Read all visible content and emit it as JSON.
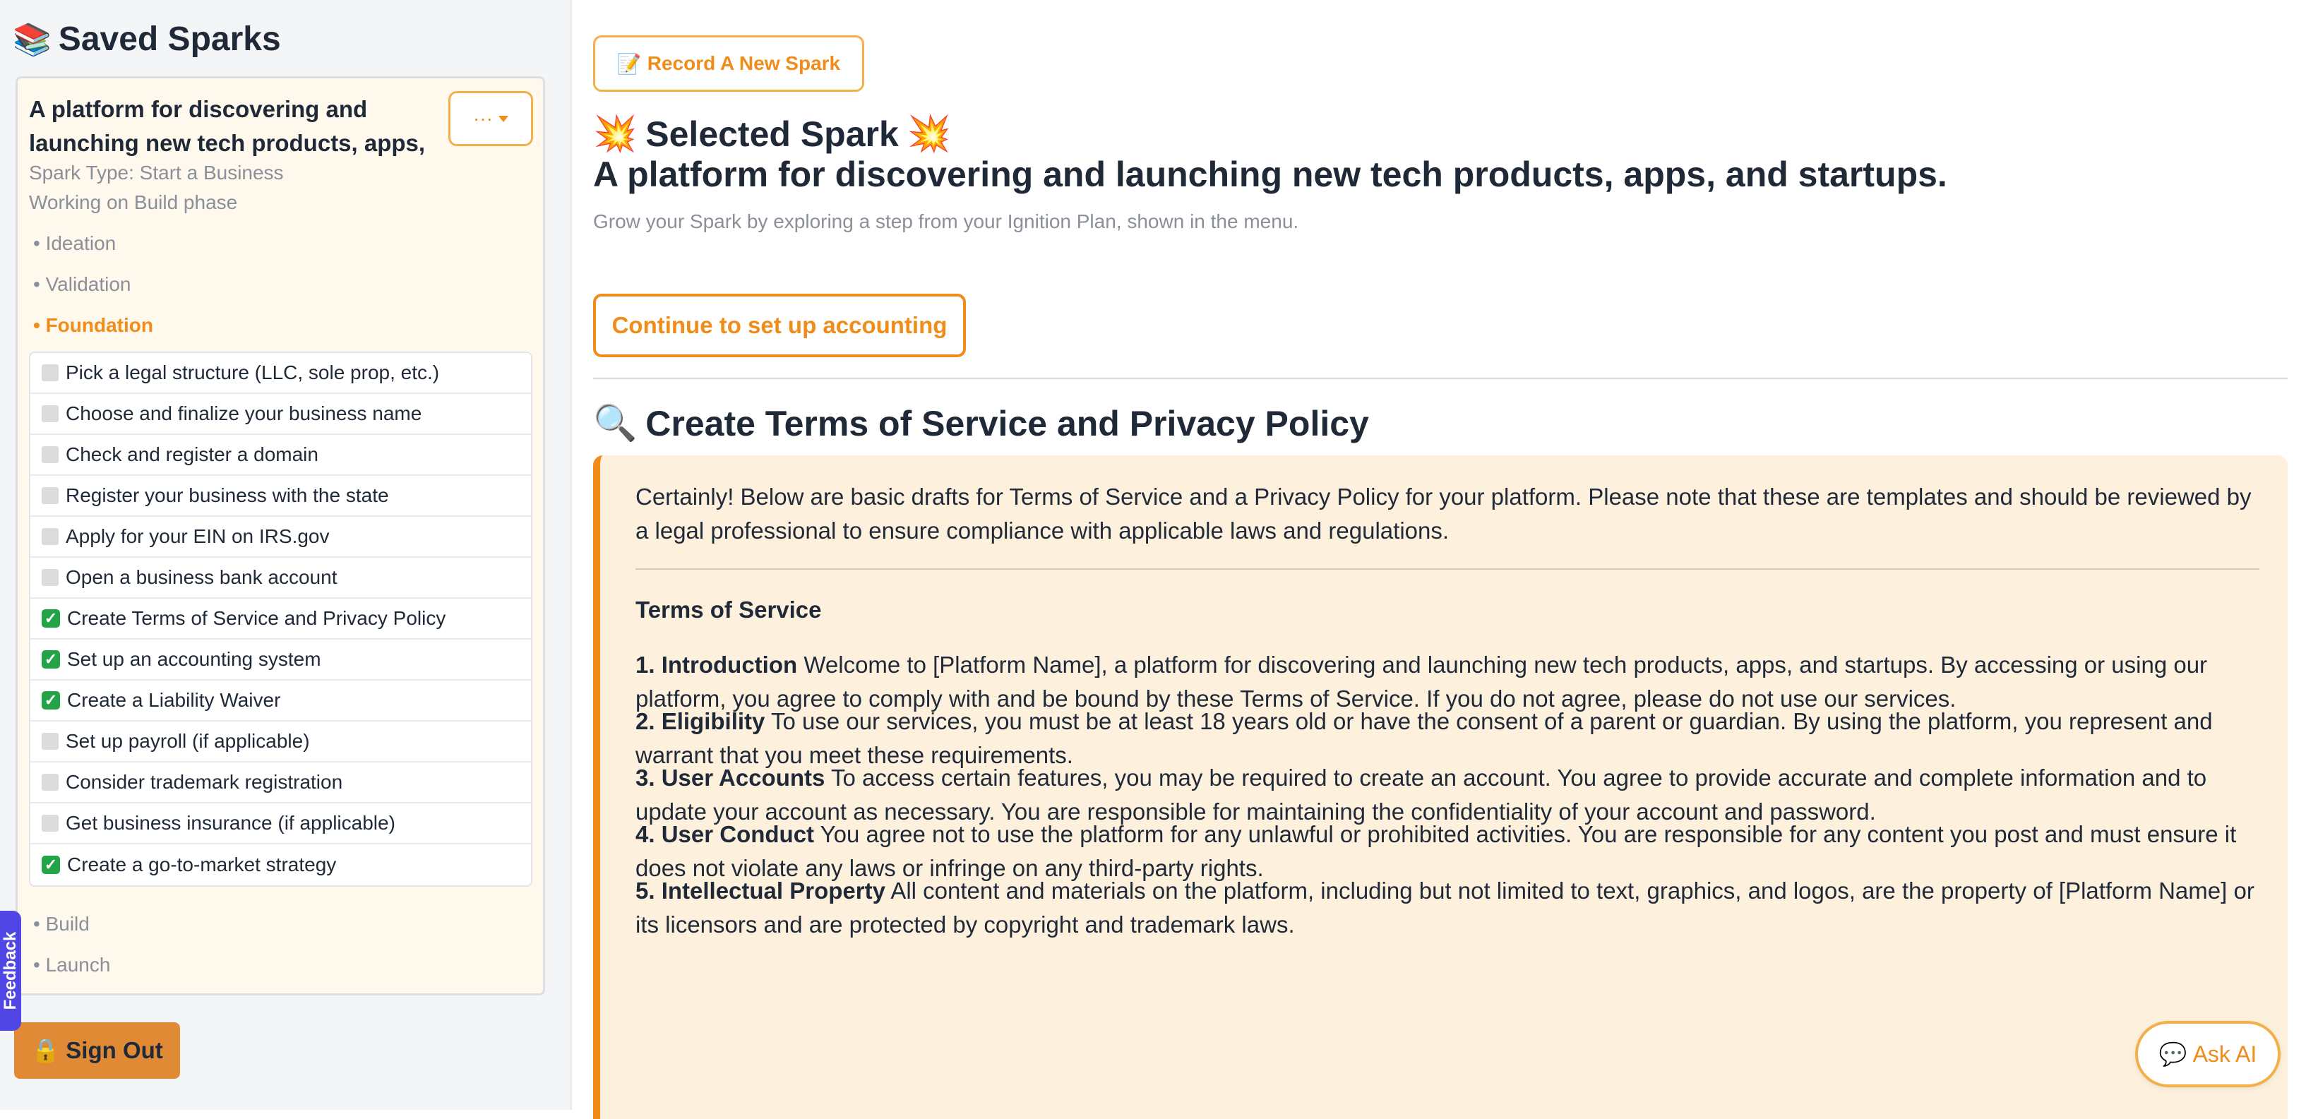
{
  "sidebar": {
    "title": "Saved Sparks",
    "title_icon": "📚",
    "card": {
      "title": "A platform for discovering and launching new tech products, apps, and startups.",
      "menu_label": "···",
      "spark_type": "Spark Type: Start a Business",
      "working_on": "Working on Build phase",
      "phases": [
        {
          "label": "• Ideation",
          "active": false
        },
        {
          "label": "• Validation",
          "active": false
        },
        {
          "label": "• Foundation",
          "active": true
        }
      ],
      "tasks": [
        {
          "label": "Pick a legal structure (LLC, sole prop, etc.)",
          "done": false
        },
        {
          "label": "Choose and finalize your business name",
          "done": false
        },
        {
          "label": "Check and register a domain",
          "done": false
        },
        {
          "label": "Register your business with the state",
          "done": false
        },
        {
          "label": "Apply for your EIN on IRS.gov",
          "done": false
        },
        {
          "label": "Open a business bank account",
          "done": false
        },
        {
          "label": "Create Terms of Service and Privacy Policy",
          "done": true
        },
        {
          "label": "Set up an accounting system",
          "done": true
        },
        {
          "label": "Create a Liability Waiver",
          "done": true
        },
        {
          "label": "Set up payroll (if applicable)",
          "done": false
        },
        {
          "label": "Consider trademark registration",
          "done": false
        },
        {
          "label": "Get business insurance (if applicable)",
          "done": false
        },
        {
          "label": "Create a go-to-market strategy",
          "done": true
        }
      ],
      "later_phases": [
        "• Build",
        "• Launch"
      ]
    },
    "signout_icon": "🔒",
    "signout_label": "Sign Out",
    "feedback_label": "Feedback"
  },
  "main": {
    "record_icon": "📝",
    "record_label": "Record A New Spark",
    "selected_icon": "💥",
    "selected_label": "Selected Spark",
    "spark_title": "A platform for discovering and launching new tech products, apps, and startups.",
    "subtext": "Grow your Spark by exploring a step from your Ignition Plan, shown in the menu.",
    "continue_label": "Continue to set up accounting",
    "step_icon": "🔍",
    "step_title": "Create Terms of Service and Privacy Policy",
    "content": {
      "intro": "Certainly! Below are basic drafts for Terms of Service and a Privacy Policy for your platform. Please note that these are templates and should be reviewed by a legal professional to ensure compliance with applicable laws and regulations.",
      "tos_heading": "Terms of Service",
      "sections": [
        {
          "heading": "1. Introduction",
          "text": "Welcome to [Platform Name], a platform for discovering and launching new tech products, apps, and startups. By accessing or using our platform, you agree to comply with and be bound by these Terms of Service. If you do not agree, please do not use our services."
        },
        {
          "heading": "2. Eligibility",
          "text": "To use our services, you must be at least 18 years old or have the consent of a parent or guardian. By using the platform, you represent and warrant that you meet these requirements."
        },
        {
          "heading": "3. User Accounts",
          "text": "To access certain features, you may be required to create an account. You agree to provide accurate and complete information and to update your account as necessary. You are responsible for maintaining the confidentiality of your account and password."
        },
        {
          "heading": "4. User Conduct",
          "text": "You agree not to use the platform for any unlawful or prohibited activities. You are responsible for any content you post and must ensure it does not violate any laws or infringe on any third-party rights."
        },
        {
          "heading": "5. Intellectual Property",
          "text": "All content and materials on the platform, including but not limited to text, graphics, and logos, are the property of [Platform Name] or its licensors and are protected by copyright and trademark laws."
        }
      ]
    },
    "askai_icon": "💬",
    "askai_label": "Ask AI"
  }
}
